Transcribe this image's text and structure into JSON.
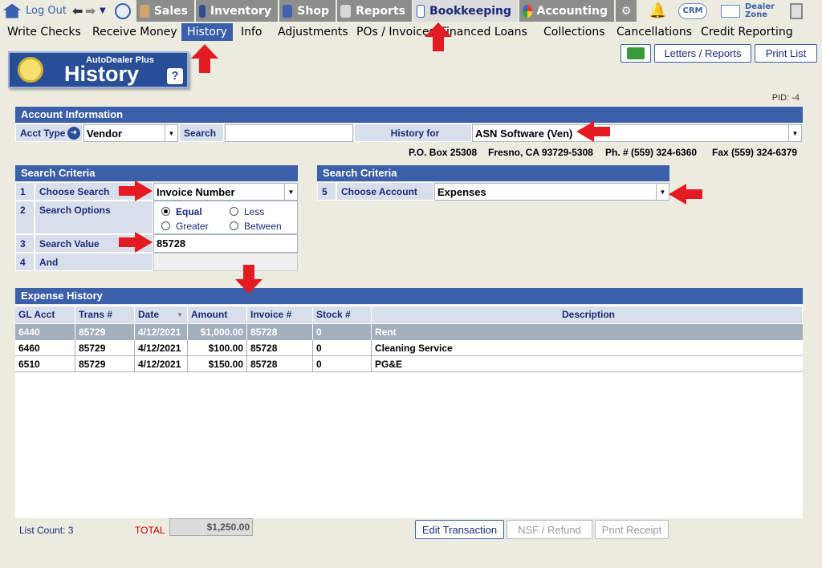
{
  "topnav": {
    "logout": "Log Out",
    "tabs": [
      "Sales",
      "Inventory",
      "Shop",
      "Reports",
      "Bookkeeping",
      "Accounting"
    ],
    "crm": "CRM",
    "dealer_zone": "Dealer Zone"
  },
  "subnav": [
    "Write Checks",
    "Receive Money",
    "History",
    "Info",
    "Adjustments",
    "POs / Invoices",
    "Financed Loans",
    "Collections",
    "Cancellations",
    "Credit Reporting"
  ],
  "badge": {
    "brand": "AutoDealer Plus",
    "title": "History",
    "help": "?"
  },
  "buttons": {
    "letters": "Letters / Reports",
    "print_list": "Print List",
    "edit_transaction": "Edit Transaction",
    "nsf_refund": "NSF / Refund",
    "print_receipt": "Print Receipt"
  },
  "pid": "PID: -4",
  "account": {
    "header": "Account Information",
    "acct_type_label": "Acct Type",
    "acct_type_value": "Vendor",
    "search_label": "Search",
    "search_value": "",
    "history_for_label": "History for",
    "history_for_value": "ASN Software (Ven)",
    "address": "P.O. Box 25308",
    "city": "Fresno, CA 93729-5308",
    "phone": "Ph. # (559) 324-6360",
    "fax": "Fax (559) 324-6379"
  },
  "criteria_left": {
    "header": "Search Criteria",
    "rows": [
      {
        "num": "1",
        "label": "Choose Search",
        "value": "Invoice Number"
      },
      {
        "num": "2",
        "label": "Search Options"
      },
      {
        "num": "3",
        "label": "Search Value",
        "value": "85728"
      },
      {
        "num": "4",
        "label": "And"
      }
    ],
    "options": [
      "Equal",
      "Less",
      "Greater",
      "Between"
    ]
  },
  "criteria_right": {
    "header": "Search Criteria",
    "num": "5",
    "label": "Choose Account",
    "value": "Expenses"
  },
  "history": {
    "header": "Expense History",
    "columns": [
      "GL Acct",
      "Trans #",
      "Date",
      "Amount",
      "Invoice #",
      "Stock #",
      "Description"
    ],
    "rows": [
      {
        "gl": "6440",
        "trans": "85729",
        "date": "4/12/2021",
        "amount": "$1,000.00",
        "invoice": "85728",
        "stock": "0",
        "desc": "Rent"
      },
      {
        "gl": "6460",
        "trans": "85729",
        "date": "4/12/2021",
        "amount": "$100.00",
        "invoice": "85728",
        "stock": "0",
        "desc": "Cleaning Service"
      },
      {
        "gl": "6510",
        "trans": "85729",
        "date": "4/12/2021",
        "amount": "$150.00",
        "invoice": "85728",
        "stock": "0",
        "desc": "PG&E"
      }
    ]
  },
  "footer": {
    "list_count": "List Count: 3",
    "total_label": "TOTAL",
    "total_value": "$1,250.00"
  }
}
